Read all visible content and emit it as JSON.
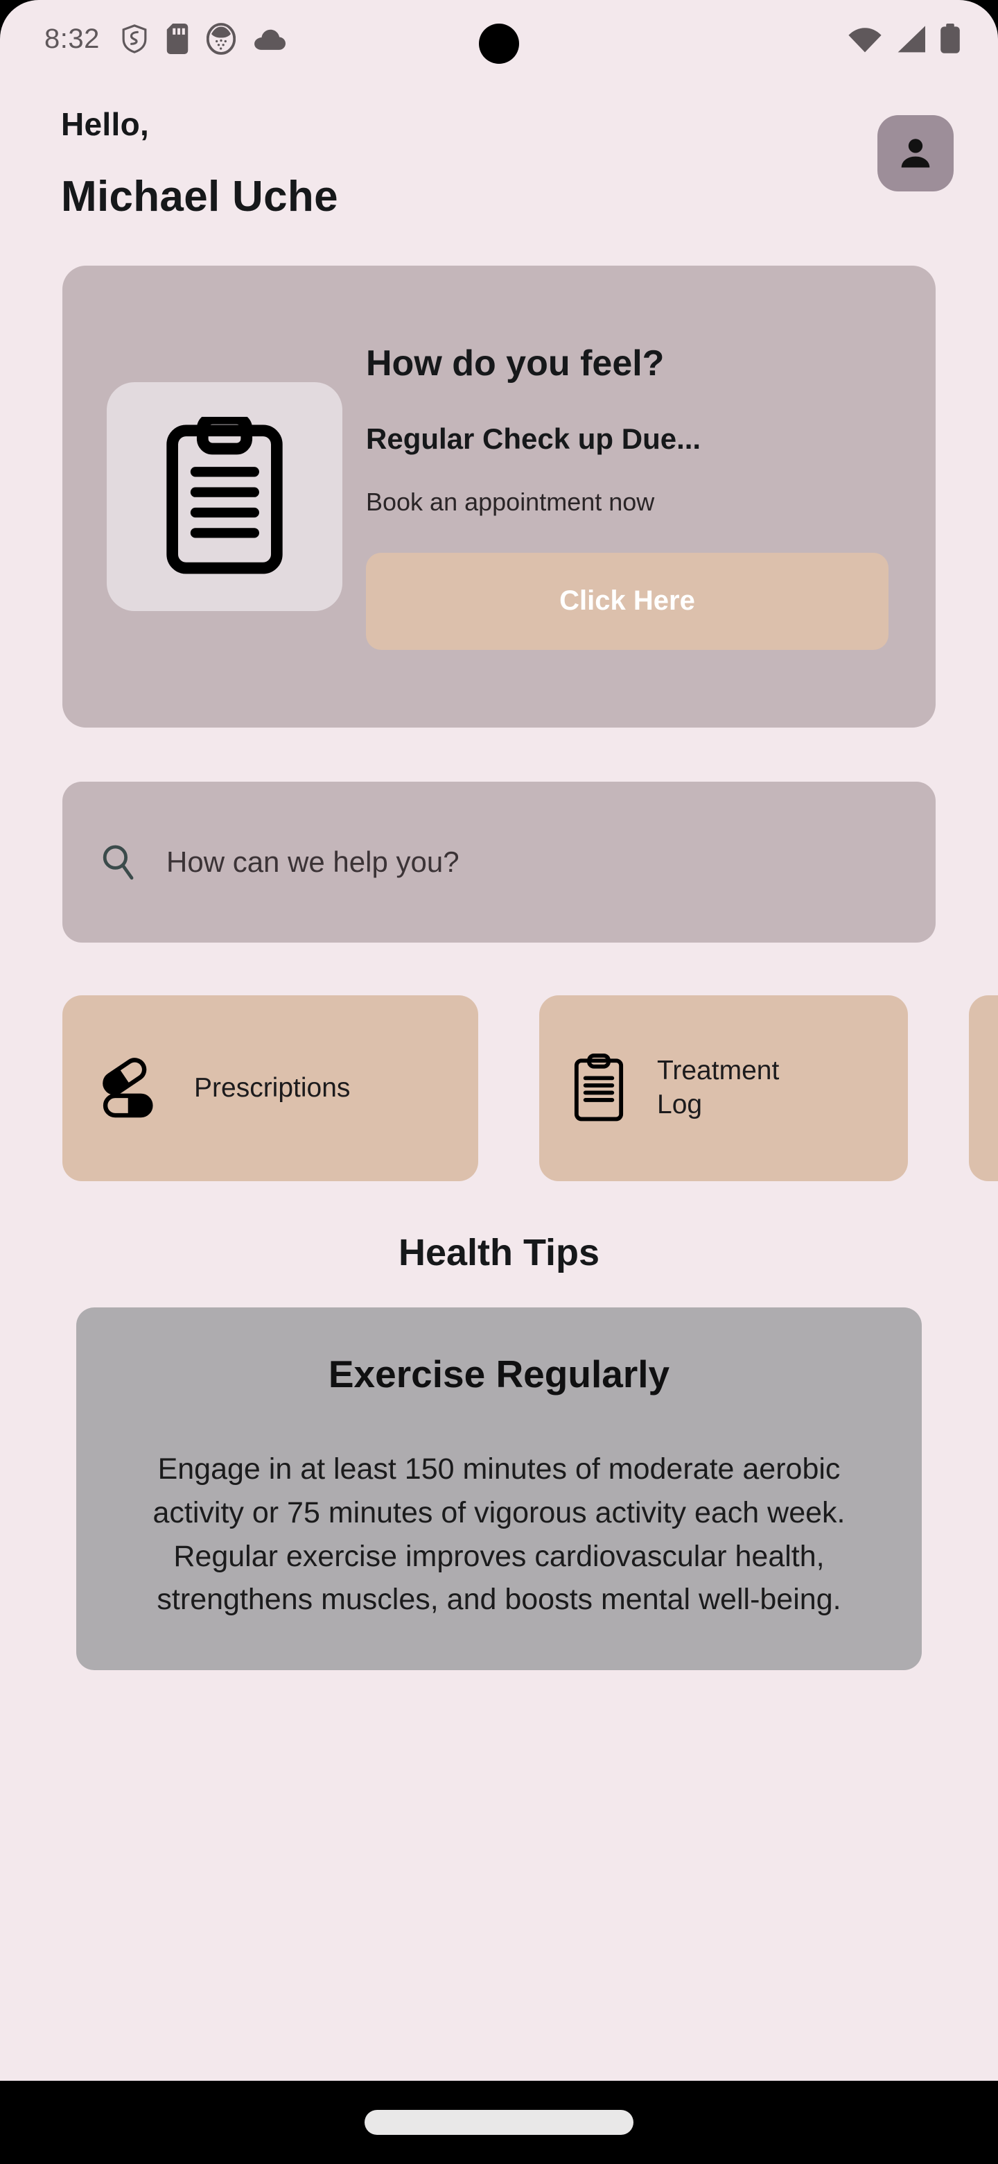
{
  "status_bar": {
    "time": "8:32",
    "left_icons": [
      "shield-icon",
      "sd-card-icon",
      "dotted-circle-icon",
      "cloud-icon"
    ],
    "right_icons": [
      "wifi-icon",
      "cellular-signal-icon",
      "battery-icon"
    ]
  },
  "header": {
    "greeting": "Hello,",
    "user_name": "Michael Uche",
    "avatar_icon": "person-icon"
  },
  "promo_card": {
    "icon": "clipboard-icon",
    "title": "How do you feel?",
    "subtitle": "Regular Check up Due...",
    "description": "Book an appointment now",
    "button_label": "Click Here",
    "button_color": "#dcc0ac",
    "card_color": "#c4b6ba"
  },
  "search": {
    "icon": "search-icon",
    "placeholder": "How can we help you?",
    "value": ""
  },
  "quick_actions": [
    {
      "label": "Prescriptions",
      "icon": "pills-icon"
    },
    {
      "label": "Treatment Log",
      "icon": "clipboard-outline-icon"
    },
    {
      "label": "",
      "icon": ""
    }
  ],
  "health_tips": {
    "heading": "Health Tips",
    "card": {
      "title": "Exercise Regularly",
      "body": "Engage in at least 150 minutes of moderate aerobic activity or 75 minutes of vigorous activity each week. Regular exercise improves cardiovascular health, strengthens muscles, and boosts mental well-being.",
      "card_color": "#aeacaf"
    }
  },
  "theme": {
    "background": "#f3e8ec",
    "accent_tan": "#dcc0ac",
    "accent_mauve": "#c4b6ba",
    "avatar_bg": "#9d8e99"
  },
  "gesture_nav": {
    "home_indicator": "home-indicator"
  }
}
